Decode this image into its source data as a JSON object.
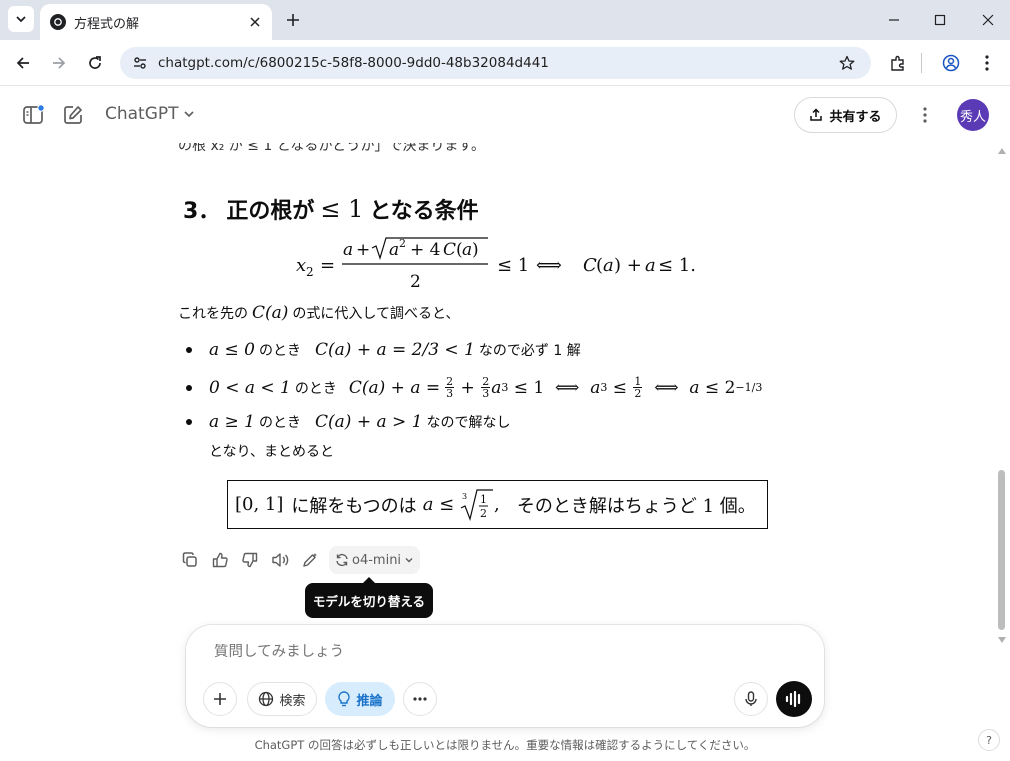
{
  "browser": {
    "tab_title": "方程式の解",
    "url": "chatgpt.com/c/6800215c-58f8-8000-9dd0-48b32084d441"
  },
  "app": {
    "model_name": "ChatGPT",
    "share_label": "共有する",
    "avatar_text": "秀人"
  },
  "content": {
    "partial_line": "の根 x₂ が ≤ 1 となるかどうか」で決まります。",
    "section_number": "3．",
    "section_title_pre": "正の根が",
    "section_title_math": "≤ 1",
    "section_title_post": "となる条件",
    "paragraph_pre": "これを先の",
    "paragraph_math": "C(a)",
    "paragraph_post": "の式に代入して調べると、",
    "bullets": [
      {
        "cond": "a ≤ 0",
        "mid": "のとき",
        "expr": "C(a) + a = 2/3 < 1",
        "tail": "なので必ず 1 解"
      },
      {
        "cond": "0 < a < 1",
        "mid": "のとき",
        "expr": "C(a) + a =",
        "tail": ""
      },
      {
        "cond": "a ≥ 1",
        "mid": "のとき",
        "expr": "C(a) + a > 1",
        "tail": "なので解なし"
      }
    ],
    "tonari": "となり、まとめると",
    "boxed_pre": "[0, 1]",
    "boxed_mid": "に解をもつのは",
    "boxed_post": "そのとき解はちょうど 1 個。"
  },
  "actions": {
    "model_switch_label": "o4-mini",
    "tooltip": "モデルを切り替える"
  },
  "composer": {
    "placeholder": "質問してみましょう",
    "search_label": "検索",
    "reason_label": "推論"
  },
  "footer": {
    "disclaimer": "ChatGPT の回答は必ずしも正しいとは限りません。重要な情報は確認するようにしてください。",
    "help": "?"
  },
  "colors": {
    "tabbar_bg": "#dfe3eb",
    "omnibox_bg": "#e8eef7",
    "avatar_bg": "#5b3bb5",
    "reason_active_bg": "#d7ecfd",
    "reason_active_fg": "#1a73c9"
  }
}
